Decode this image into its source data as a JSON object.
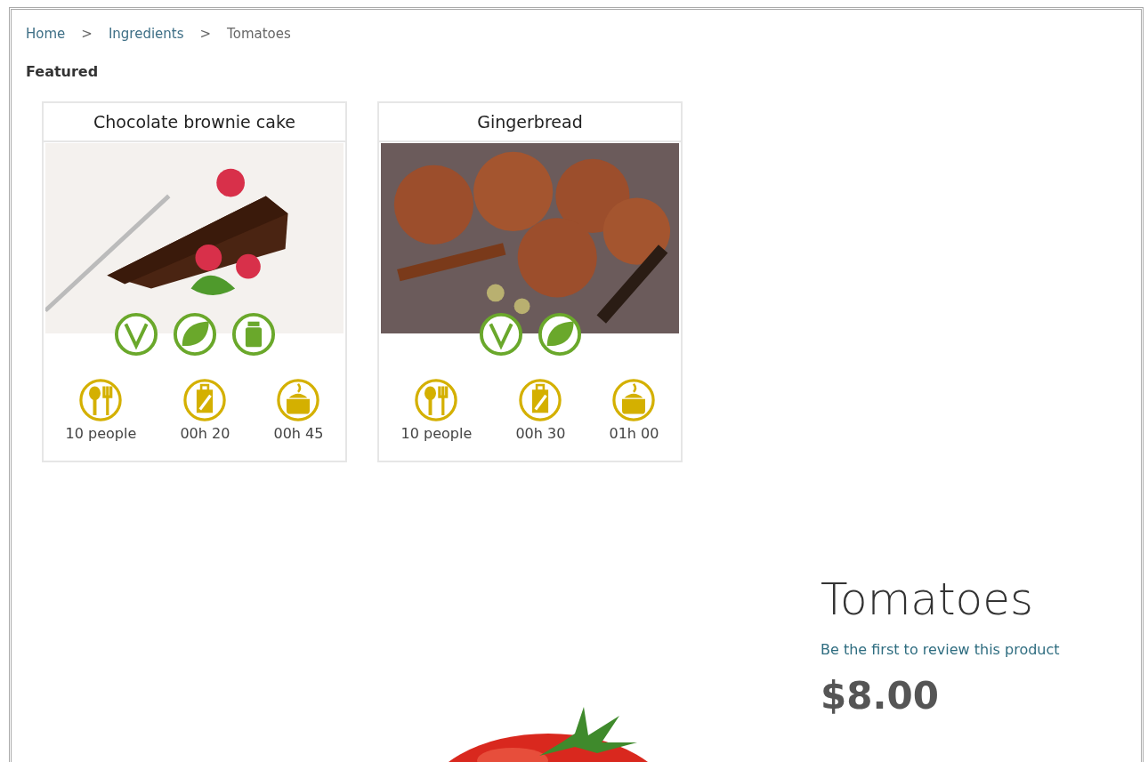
{
  "breadcrumbs": [
    {
      "label": "Home",
      "kind": "link"
    },
    {
      "label": ">",
      "kind": "separator"
    },
    {
      "label": "Ingredients",
      "kind": "link"
    },
    {
      "label": ">",
      "kind": "separator"
    },
    {
      "label": "Tomatoes",
      "kind": "current"
    }
  ],
  "featured": {
    "heading": "Featured",
    "recipes": [
      {
        "title": "Chocolate brownie cake",
        "kind": "cake",
        "badges": [
          {
            "kind": "vegetarian"
          },
          {
            "kind": "vegan"
          },
          {
            "kind": "jar"
          }
        ],
        "meta": [
          {
            "kind": "servings",
            "text": "10 people"
          },
          {
            "kind": "prep",
            "text": "00h 20"
          },
          {
            "kind": "cook",
            "text": "00h 45"
          }
        ]
      },
      {
        "title": "Gingerbread",
        "kind": "cookies",
        "badges": [
          {
            "kind": "vegetarian"
          },
          {
            "kind": "vegan"
          }
        ],
        "meta": [
          {
            "kind": "servings",
            "text": "10 people"
          },
          {
            "kind": "prep",
            "text": "00h 30"
          },
          {
            "kind": "cook",
            "text": "01h 00"
          }
        ]
      }
    ]
  },
  "product": {
    "name": "Tomatoes",
    "review_link": "Be the first to review this product",
    "price": "$8.00"
  }
}
